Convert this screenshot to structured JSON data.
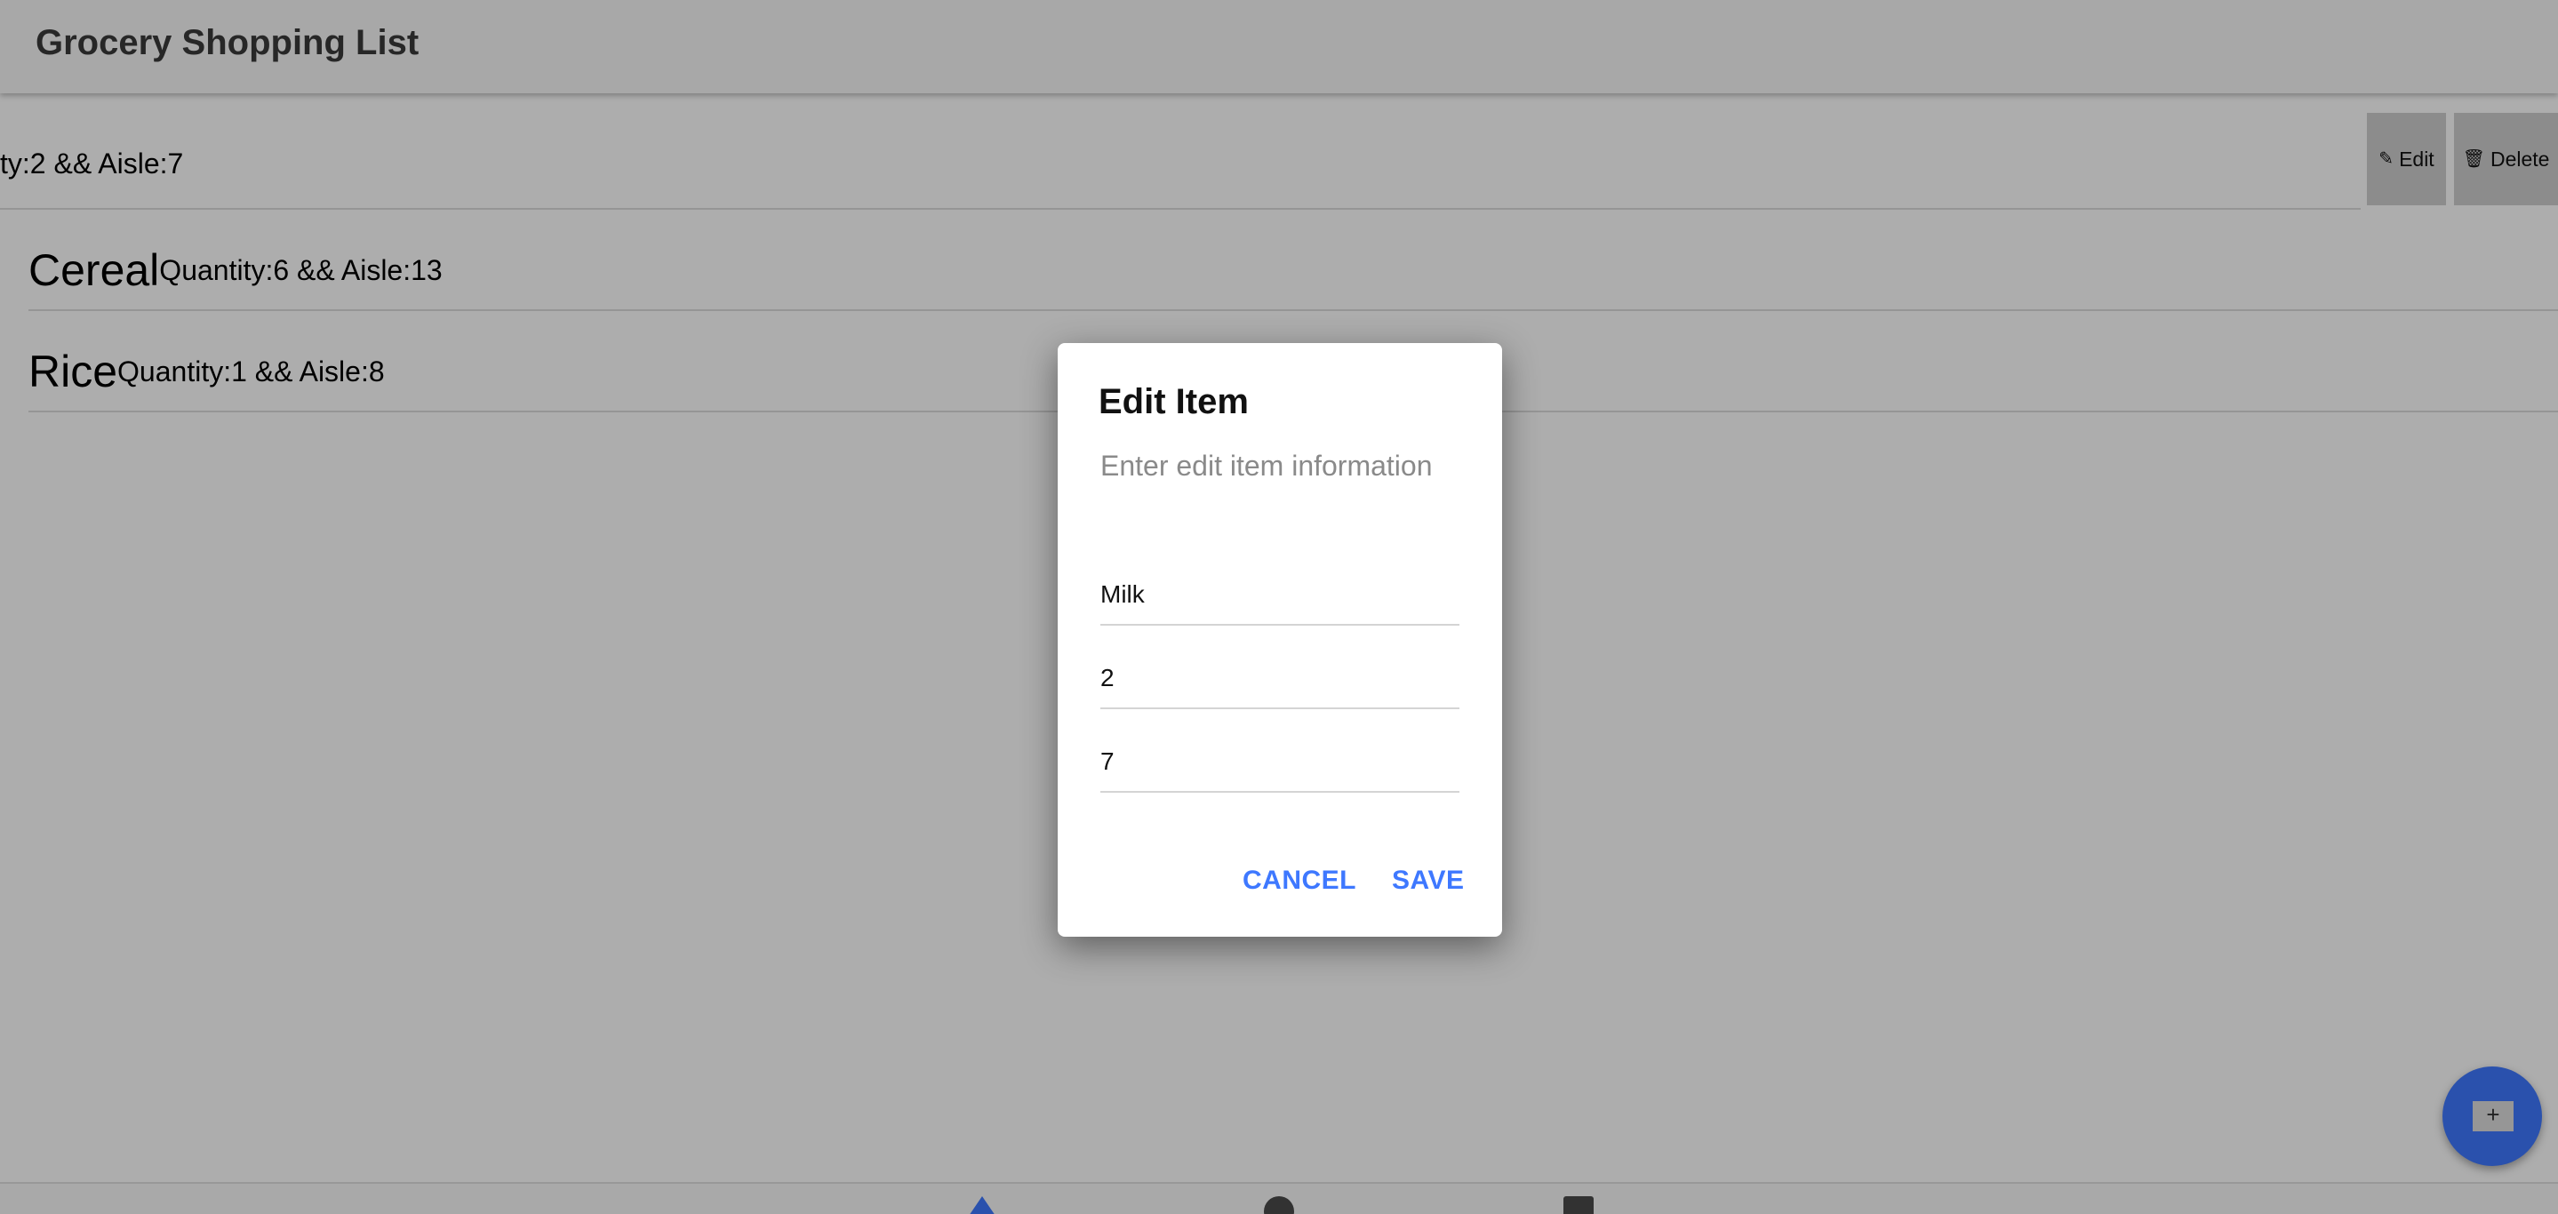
{
  "header": {
    "title": "Grocery Shopping List"
  },
  "list": {
    "swiped_item": {
      "detail": "ty:2 && Aisle:7",
      "edit_label": "Edit",
      "delete_label": "Delete"
    },
    "items": [
      {
        "name": "Cereal",
        "detail": "Quantity:6 && Aisle:13"
      },
      {
        "name": "Rice",
        "detail": "Quantity:1 && Aisle:8"
      }
    ]
  },
  "dialog": {
    "title": "Edit Item",
    "subtitle": "Enter edit item information",
    "fields": {
      "name": "Milk",
      "quantity": "2",
      "aisle": "7"
    },
    "cancel_label": "CANCEL",
    "save_label": "SAVE"
  },
  "fab": {
    "label": "+"
  },
  "icons": {
    "edit": "edit-icon",
    "delete": "trash-icon",
    "home": "home-icon",
    "circle": "circle-tab-icon",
    "square": "square-tab-icon",
    "add": "add-icon"
  },
  "colors": {
    "accent": "#3e78ff",
    "overlay": "rgba(0,0,0,0.32)"
  }
}
